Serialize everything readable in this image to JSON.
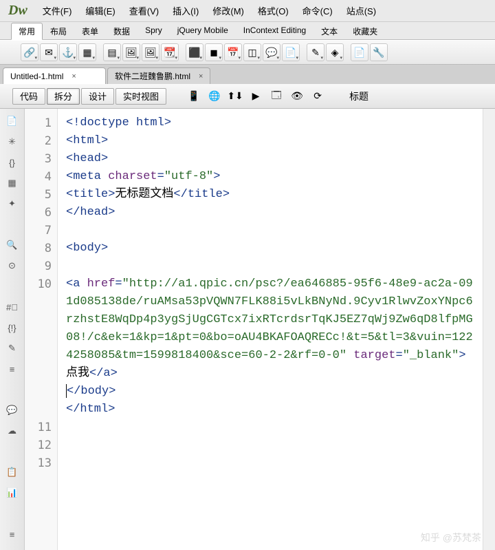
{
  "logo": "Dw",
  "menu": [
    "文件(F)",
    "编辑(E)",
    "查看(V)",
    "插入(I)",
    "修改(M)",
    "格式(O)",
    "命令(C)",
    "站点(S)"
  ],
  "insert_tabs": {
    "active": 0,
    "items": [
      "常用",
      "布局",
      "表单",
      "数据",
      "Spry",
      "jQuery Mobile",
      "InContext Editing",
      "文本",
      "收藏夹"
    ]
  },
  "icon_row": [
    "🔗",
    "✉",
    "⚓",
    "▦",
    "▤",
    "🖼",
    "🖼",
    "📆",
    "⬛",
    "◼",
    "📅",
    "◫",
    "💬",
    "📄",
    "✎",
    "◈",
    "📄",
    "🔧"
  ],
  "doc_tabs": [
    {
      "label": "Untitled-1.html",
      "active": true
    },
    {
      "label": "软件二班魏鲁鹏.html",
      "active": false
    }
  ],
  "view_buttons": {
    "active": 1,
    "items": [
      "代码",
      "拆分",
      "设计",
      "实时视图"
    ]
  },
  "doc_tool_icons": [
    "📱",
    "🌐",
    "⬆⬇",
    "▶",
    "🗔",
    "👁",
    "⟳"
  ],
  "title_label": "标题",
  "gutter_icons": [
    "📄",
    "✳",
    "{}",
    "▦",
    "✦",
    "",
    "🔍",
    "⊙",
    "",
    "#⃣",
    "{!}",
    "✎",
    "≡",
    "",
    "💬",
    "☁",
    "",
    "📋",
    "📊",
    "",
    "≡"
  ],
  "code": {
    "lines": [
      {
        "n": "1",
        "seg": [
          {
            "c": "c-kw",
            "t": "<!doctype html>"
          }
        ]
      },
      {
        "n": "2",
        "seg": [
          {
            "c": "c-tag",
            "t": "<html>"
          }
        ]
      },
      {
        "n": "3",
        "seg": [
          {
            "c": "c-tag",
            "t": "<head>"
          }
        ]
      },
      {
        "n": "4",
        "seg": [
          {
            "c": "c-tag",
            "t": "<meta "
          },
          {
            "c": "c-attr",
            "t": "charset"
          },
          {
            "c": "c-tag",
            "t": "="
          },
          {
            "c": "c-str",
            "t": "\"utf-8\""
          },
          {
            "c": "c-tag",
            "t": ">"
          }
        ]
      },
      {
        "n": "5",
        "seg": [
          {
            "c": "c-tag",
            "t": "<title>"
          },
          {
            "c": "c-txt",
            "t": "无标题文档"
          },
          {
            "c": "c-tag",
            "t": "</title>"
          }
        ]
      },
      {
        "n": "6",
        "seg": [
          {
            "c": "c-tag",
            "t": "</head>"
          }
        ]
      },
      {
        "n": "7",
        "seg": []
      },
      {
        "n": "8",
        "seg": [
          {
            "c": "c-tag",
            "t": "<body>"
          }
        ]
      },
      {
        "n": "9",
        "seg": []
      },
      {
        "n": "10",
        "seg": [
          {
            "c": "c-tag",
            "t": "<a "
          },
          {
            "c": "c-attr",
            "t": "href"
          },
          {
            "c": "c-tag",
            "t": "="
          },
          {
            "c": "c-str",
            "t": "\"http://a1.qpic.cn/psc?/ea646885-95f6-48e9-ac2a-091d085138de/ruAMsa53pVQWN7FLK88i5vLkBNyNd.9Cyv1RlwvZoxYNpc6rzhstE8WqDp4p3ygSjUgCGTcx7ixRTcrdsrTqKJ5EZ7qWj9Zw6qD8lfpMG08!/c&ek=1&kp=1&pt=0&bo=oAU4BKAFOAQRECc!&t=5&tl=3&vuin=1224258085&tm=1599818400&sce=60-2-2&rf=0-0\""
          },
          {
            "c": "c-tag",
            "t": " "
          },
          {
            "c": "c-attr",
            "t": "target"
          },
          {
            "c": "c-tag",
            "t": "="
          },
          {
            "c": "c-str",
            "t": "\"_blank\""
          },
          {
            "c": "c-tag",
            "t": ">"
          },
          {
            "c": "c-txt",
            "t": "点我"
          },
          {
            "c": "c-tag",
            "t": "</a>"
          }
        ]
      },
      {
        "n": "11",
        "seg": [
          {
            "c": "c-tag",
            "t": "</body>"
          }
        ],
        "cursor": true
      },
      {
        "n": "12",
        "seg": [
          {
            "c": "c-tag",
            "t": "</html>"
          }
        ]
      },
      {
        "n": "13",
        "seg": []
      }
    ]
  },
  "watermark": "知乎 @苏梵茶"
}
